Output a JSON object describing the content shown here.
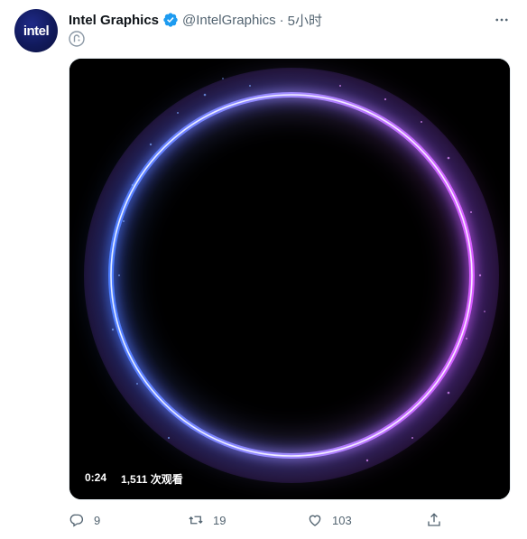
{
  "tweet": {
    "avatar_text": "intel",
    "author_name": "Intel Graphics",
    "handle": "@IntelGraphics",
    "separator": "·",
    "time": "5小时",
    "video": {
      "duration": "0:24",
      "views": "1,511 次观看"
    },
    "actions": {
      "reply_count": "9",
      "retweet_count": "19",
      "like_count": "103"
    },
    "colors": {
      "verified": "#1d9bf0",
      "ring_left": "#4d7dff",
      "ring_right": "#d65cff",
      "secondary_text": "#536471"
    },
    "icons": [
      "verified-badge-icon",
      "more-icon",
      "subscription-icon",
      "reply-icon",
      "retweet-icon",
      "like-icon",
      "share-icon"
    ]
  }
}
